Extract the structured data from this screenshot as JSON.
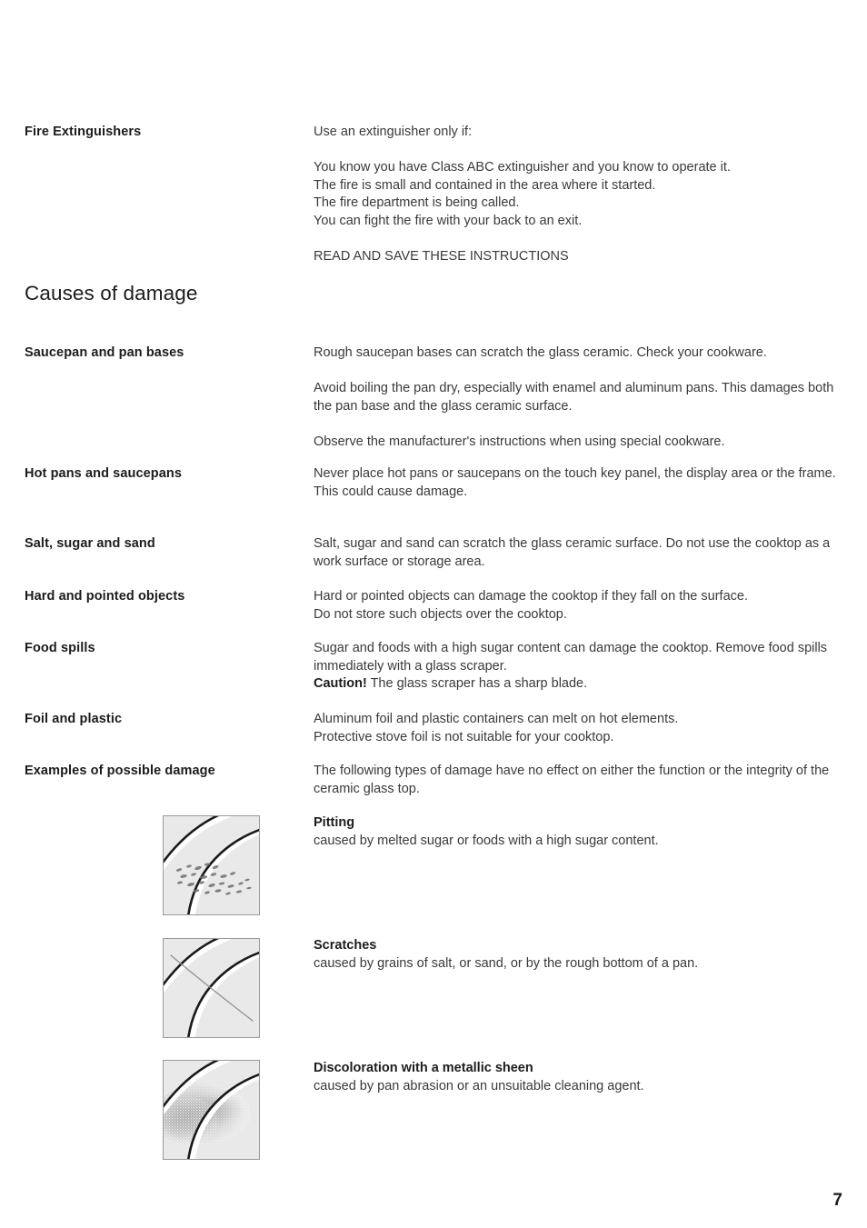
{
  "page": {
    "number": "7",
    "section_heading": "Causes of damage"
  },
  "entries": [
    {
      "label": "Fire Extinguishers",
      "paragraphs": [
        "Use an extinguisher only if:",
        "You know you have Class ABC extinguisher and you know to operate it.\nThe fire is small and contained in the area where it started.\nThe fire department is being called.\nYou can fight the fire with your back to an exit.",
        "READ AND SAVE THESE INSTRUCTIONS"
      ]
    },
    {
      "label": "Saucepan and pan bases",
      "paragraphs": [
        "Rough saucepan bases can scratch the glass ceramic. Check your cookware.",
        "Avoid boiling the pan dry, especially with enamel and aluminum pans. This damages both the pan base and the glass ceramic surface.",
        "Observe the manufacturer's instructions when using special cookware."
      ]
    },
    {
      "label": "Hot pans and saucepans",
      "paragraphs": [
        "Never place hot pans or saucepans on the touch key panel, the display area or the frame.\nThis could cause damage."
      ]
    },
    {
      "label": "Salt, sugar and sand",
      "paragraphs": [
        "Salt, sugar and sand can scratch the glass ceramic surface. Do not use the cooktop as a work surface or storage area."
      ]
    },
    {
      "label": "Hard and pointed objects",
      "paragraphs": [
        "Hard or pointed objects can damage the cooktop if they fall on the surface.\nDo not store such objects over the cooktop."
      ]
    },
    {
      "label": "Food spills",
      "paragraphs": [
        "Sugar and foods with a high sugar content can damage the cooktop. Remove food spills immediately with a glass scraper."
      ],
      "caution": {
        "bold": "Caution!",
        "rest": " The glass scraper has a sharp blade."
      }
    },
    {
      "label": "Foil and plastic",
      "paragraphs": [
        "Aluminum foil and plastic containers can melt on hot elements.\nProtective stove foil is not suitable for your cooktop."
      ]
    },
    {
      "label": "Examples of possible damage",
      "paragraphs": [
        "The following types of damage have no effect on either the function or the integrity of the ceramic glass top."
      ]
    }
  ],
  "examples": [
    {
      "title": "Pitting",
      "description": "caused by melted sugar or foods with a high sugar content.",
      "illustration": "cooktop-pitting-illustration"
    },
    {
      "title": "Scratches",
      "description": "caused by grains of salt, or sand, or by the rough bottom of a pan.",
      "illustration": "cooktop-scratches-illustration"
    },
    {
      "title": "Discoloration with a metallic sheen",
      "description": "caused by pan abrasion or an unsuitable cleaning agent.",
      "illustration": "cooktop-discoloration-illustration"
    }
  ],
  "colors": {
    "text_heading": "#1c1c1c",
    "text_body": "#3a3a3a",
    "illustration_bg": "#e9e9e9",
    "illustration_border": "#9a9a9a",
    "arc_dark": "#1a1a1a"
  }
}
